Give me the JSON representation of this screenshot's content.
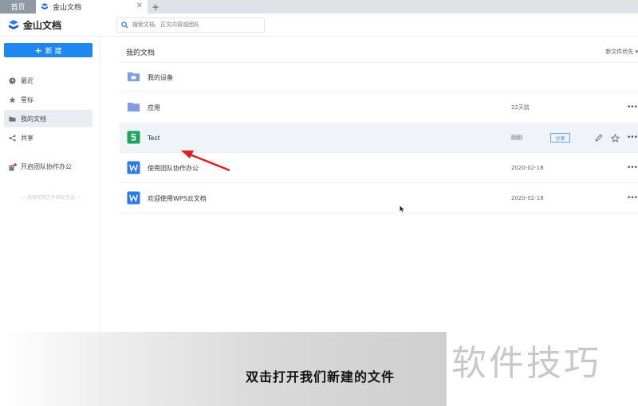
{
  "tabs": {
    "home": "首页",
    "doc": "金山文档",
    "close": "✕",
    "add": "+"
  },
  "header": {
    "brand": "金山文档",
    "search_placeholder": "搜索文档、正文内容或团队"
  },
  "sidebar": {
    "new_label": "新 建",
    "items": [
      {
        "label": "最近",
        "icon": "clock-icon"
      },
      {
        "label": "星标",
        "icon": "star-icon"
      },
      {
        "label": "我的文档",
        "icon": "folder-icon"
      },
      {
        "label": "共享",
        "icon": "share-icon"
      }
    ],
    "team_link": "开启团队协作办公",
    "drag_hint": "— 拖拽常用文件固定至此 —"
  },
  "main": {
    "title": "我的文档",
    "sort": "新文件优先 ▾",
    "files": [
      {
        "name": "我的设备",
        "date": "",
        "type": "folder",
        "icon_color": "#7e9ee0"
      },
      {
        "name": "应用",
        "date": "22天前",
        "type": "folder",
        "icon_color": "#7e9ee0"
      },
      {
        "name": "Test",
        "date": "刚刚",
        "type": "sheet",
        "icon_color": "#1ea362",
        "share": "分享"
      },
      {
        "name": "使用团队协作办公",
        "date": "2020-02-18",
        "type": "word",
        "icon_color": "#2e7ae6"
      },
      {
        "name": "欢迎使用WPS云文档",
        "date": "2020-02-18",
        "type": "word",
        "icon_color": "#2e7ae6"
      }
    ],
    "more": "•••"
  },
  "overlay": {
    "caption": "双击打开我们新建的文件",
    "watermark": "软件技巧",
    "arrow_color": "#e02020"
  }
}
